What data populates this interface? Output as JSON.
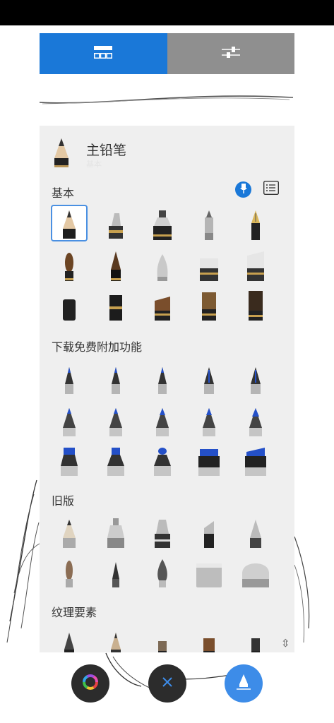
{
  "tabs": [
    {
      "name": "brush-library-tab",
      "icon": "grid-icon",
      "active": true
    },
    {
      "name": "brush-settings-tab",
      "icon": "sliders-icon",
      "active": false
    }
  ],
  "current_brush": {
    "name": "主铅笔",
    "category": "基本"
  },
  "sections": {
    "basic": "基本",
    "free_addons": "下载免费附加功能",
    "legacy": "旧版",
    "texture": "纹理要素"
  },
  "bottom_toolbar": {
    "color": "color-wheel-icon",
    "close": "close-icon",
    "brush": "brush-icon"
  },
  "colors": {
    "accent": "#1a78d8",
    "tab_inactive": "#8f8f8f",
    "panel": "#efefef"
  }
}
